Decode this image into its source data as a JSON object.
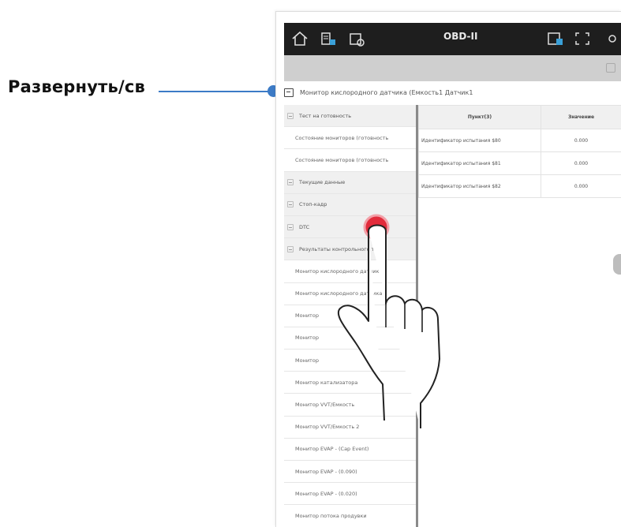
{
  "callout": {
    "label": "Развернуть/св"
  },
  "app": {
    "title": "OBD-II"
  },
  "title_row": {
    "text": "Монитор кислородного датчика (Емкость1 Датчик1"
  },
  "left_list": [
    {
      "label": "Тест на готовность",
      "kind": "group"
    },
    {
      "label": "Состояние мониторов (готовность",
      "kind": "child"
    },
    {
      "label": "Состояние мониторов (готовность",
      "kind": "child"
    },
    {
      "label": "Текущие данные",
      "kind": "group"
    },
    {
      "label": "Стоп-кадр",
      "kind": "group"
    },
    {
      "label": "DTC",
      "kind": "group"
    },
    {
      "label": "Результаты контрольного теста",
      "kind": "group"
    },
    {
      "label": "Монитор кислородного датчика",
      "kind": "child"
    },
    {
      "label": "Монитор кислородного датчика",
      "kind": "child"
    },
    {
      "label": "Монитор",
      "kind": "child"
    },
    {
      "label": "Монитор",
      "kind": "child"
    },
    {
      "label": "Монитор",
      "kind": "child"
    },
    {
      "label": "Монитор катализатора",
      "kind": "child"
    },
    {
      "label": "Монитор VVT/Емкость",
      "kind": "child"
    },
    {
      "label": "Монитор VVT/Емкость 2",
      "kind": "child"
    },
    {
      "label": "Монитор EVAP - (Cap Event)",
      "kind": "child"
    },
    {
      "label": "Монитор EVAP - (0.090)",
      "kind": "child"
    },
    {
      "label": "Монитор EVAP - (0.020)",
      "kind": "child"
    },
    {
      "label": "Монитор потока продувки",
      "kind": "child"
    }
  ],
  "table": {
    "headers": [
      "Пункт(3)",
      "Значение"
    ],
    "rows": [
      [
        "Идентификатор испытания $80",
        "0.000"
      ],
      [
        "Идентификатор испытания $81",
        "0.000"
      ],
      [
        "Идентификатор испытания $82",
        "0.000"
      ]
    ]
  },
  "colors": {
    "accent": "#3c7bc6",
    "touch": "#e22b3b",
    "topbar": "#1e1e1e"
  },
  "icons": [
    "home-icon",
    "vehicle-icon",
    "car-refresh-icon",
    "screenshot-icon",
    "fullscreen-icon",
    "settings-icon"
  ]
}
